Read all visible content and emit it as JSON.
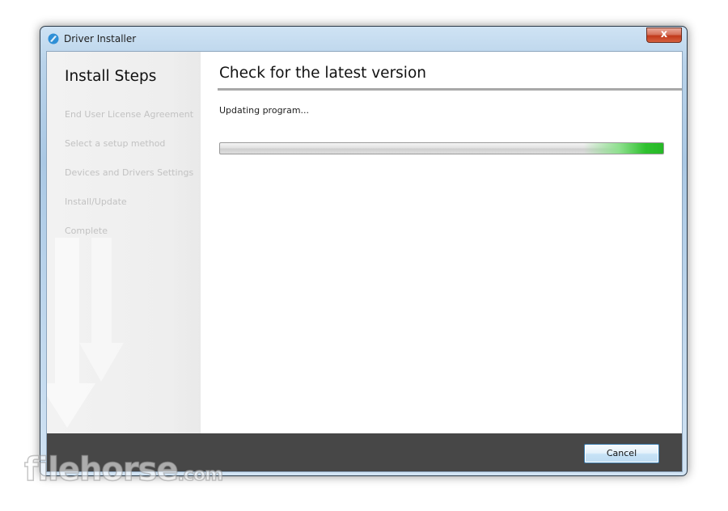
{
  "window": {
    "title": "Driver Installer",
    "close_label": "x"
  },
  "sidebar": {
    "title": "Install Steps",
    "steps": [
      "End User License Agreement",
      "Select a setup method",
      "Devices and Drivers Settings",
      "Install/Update",
      "Complete"
    ]
  },
  "main": {
    "title": "Check for the latest version",
    "status": "Updating program...",
    "progress": "indeterminate (green glow at right end)"
  },
  "footer": {
    "cancel_label": "Cancel"
  },
  "watermark": {
    "brand": "filehorse",
    "suffix": ".com"
  },
  "colors": {
    "progress_glow": "#2fc12f",
    "footer_bg": "#474747",
    "step_text": "#c2c2c2"
  }
}
